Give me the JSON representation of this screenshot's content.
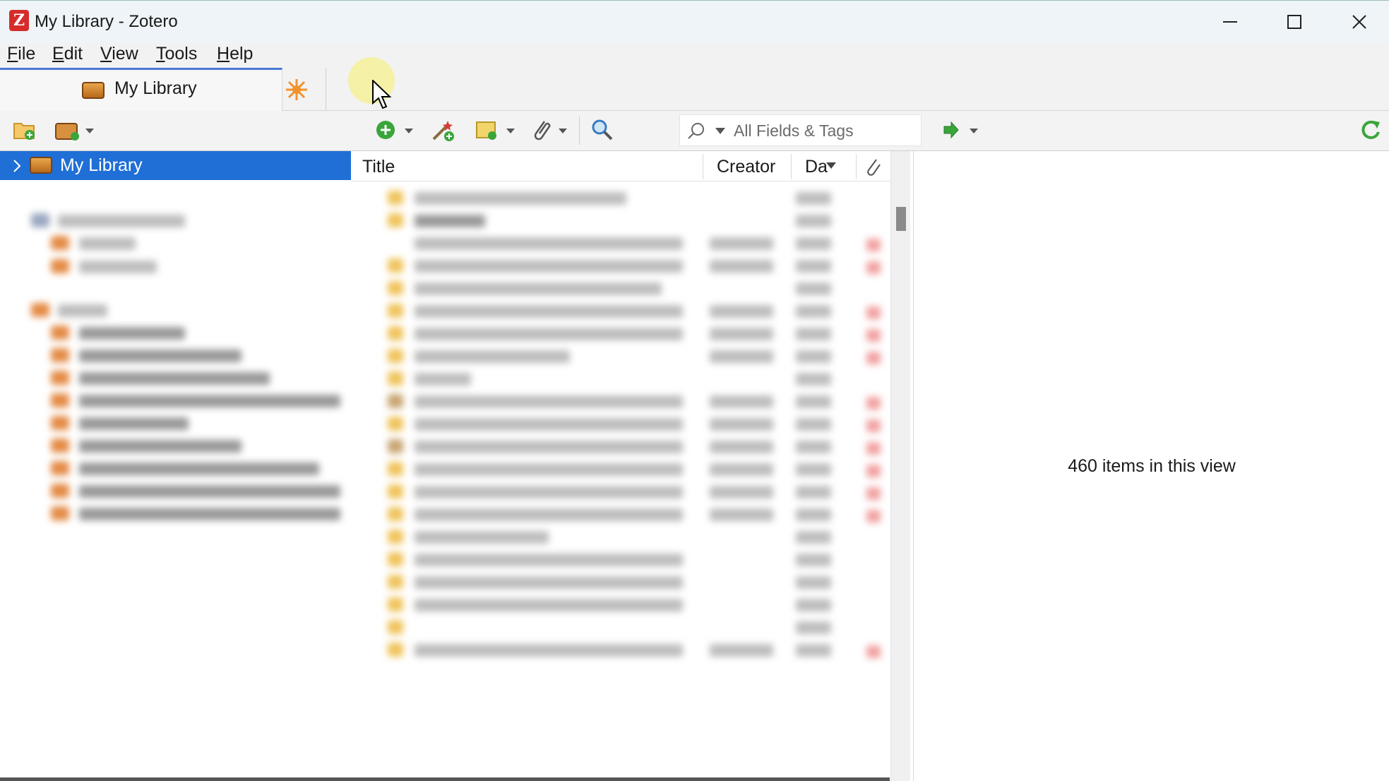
{
  "window": {
    "title": "My Library - Zotero",
    "app_icon_letter": "Z"
  },
  "menu": [
    "File",
    "Edit",
    "View",
    "Tools",
    "Help"
  ],
  "tabs": {
    "active_label": "My Library"
  },
  "toolbar": {
    "icons": [
      "new-collection-icon",
      "new-library-icon",
      "new-item-icon",
      "add-by-identifier-icon",
      "new-note-icon",
      "add-attachment-icon",
      "advanced-search-icon",
      "locate-icon",
      "sync-icon"
    ],
    "search_placeholder": "All Fields & Tags"
  },
  "collections": {
    "selected": "My Library"
  },
  "items_table": {
    "columns": [
      "Title",
      "Creator",
      "Da"
    ]
  },
  "item_pane": {
    "message": "460 items in this view"
  },
  "colors": {
    "selection": "#1f6fd6",
    "accent_tab": "#4a78d6",
    "sync_green": "#3aa53a",
    "app_red": "#d62b2b"
  }
}
